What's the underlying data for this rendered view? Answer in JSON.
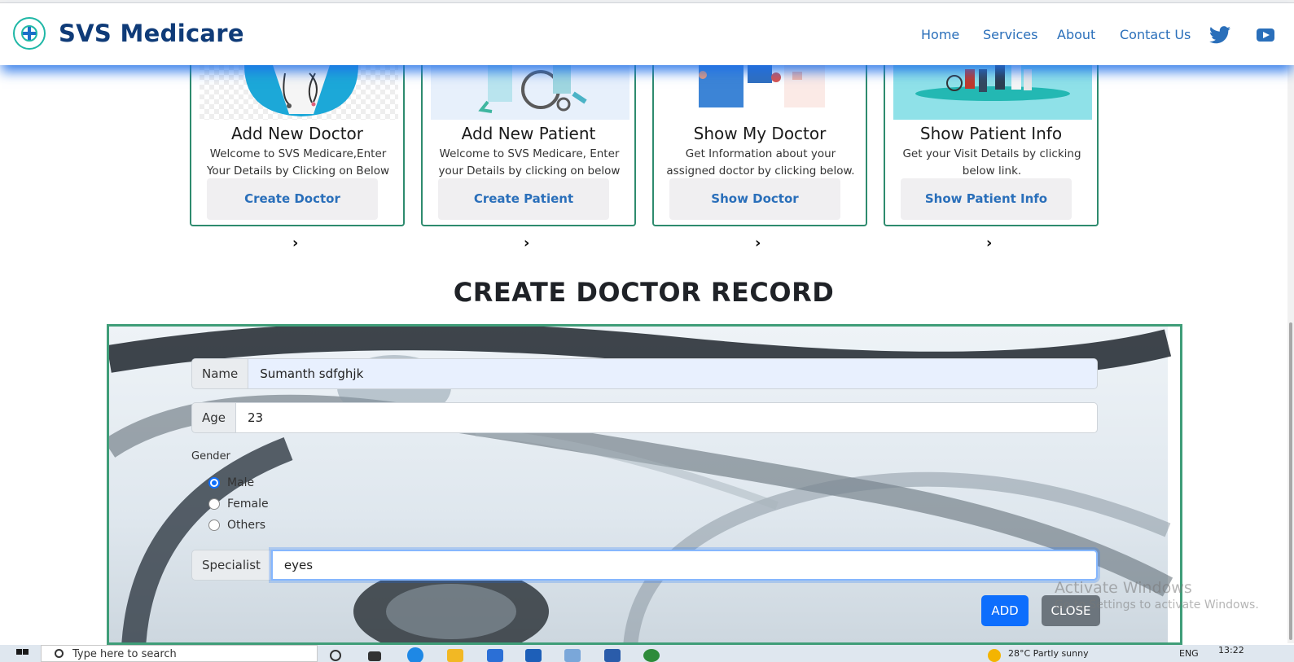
{
  "brand": {
    "name": "SVS Medicare",
    "accent": "#0f3b78",
    "logo_color": "#1fb7a6"
  },
  "nav": {
    "links": [
      "Home",
      "Services",
      "About",
      "Contact Us"
    ],
    "icons": [
      "twitter-icon",
      "youtube-icon"
    ],
    "link_color": "#2a6fba"
  },
  "cards": [
    {
      "title": "Add New Doctor",
      "text": "Welcome to SVS Medicare,Enter Your Details by Clicking on Below Button.",
      "button": "Create Doctor"
    },
    {
      "title": "Add New Patient",
      "text": "Welcome to SVS Medicare, Enter your Details by clicking on below link.",
      "button": "Create Patient"
    },
    {
      "title": "Show My Doctor",
      "text": "Get Information about your assigned doctor by clicking below.",
      "button": "Show Doctor"
    },
    {
      "title": "Show Patient Info",
      "text": "Get your Visit Details by clicking below link.",
      "button": "Show Patient Info"
    }
  ],
  "chevron": "›",
  "form": {
    "title": "CREATE DOCTOR RECORD",
    "name_label": "Name",
    "name_value": "Sumanth sdfghjk",
    "age_label": "Age",
    "age_value": "23",
    "gender_label": "Gender",
    "gender_options": [
      "Male",
      "Female",
      "Others"
    ],
    "gender_selected": "Male",
    "specialist_label": "Specialist",
    "specialist_value": "eyes",
    "add_label": "ADD",
    "close_label": "CLOSE",
    "border_color": "#3f9d78"
  },
  "watermark": {
    "line1": "Activate Windows",
    "line2": "Go to Settings to activate Windows."
  },
  "taskbar": {
    "search_placeholder": "Type here to search",
    "weather": "28°C  Partly sunny",
    "language": "ENG",
    "time": "13:22"
  }
}
